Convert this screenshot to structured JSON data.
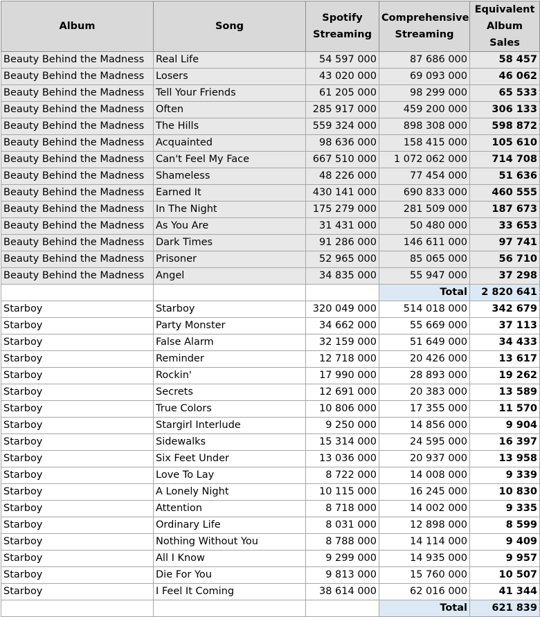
{
  "headers": {
    "album": "Album",
    "song": "Song",
    "spotify": "Spotify Streaming",
    "comprehensive": "Comprehensive Streaming",
    "equivalent": "Equivalent Album Sales"
  },
  "total_label": "Total",
  "section1": {
    "rows": [
      {
        "album": "Beauty Behind the Madness",
        "song": "Real Life",
        "spotify": "54 597 000",
        "comprehensive": "87 686 000",
        "sales": "58 457"
      },
      {
        "album": "Beauty Behind the Madness",
        "song": "Losers",
        "spotify": "43 020 000",
        "comprehensive": "69 093 000",
        "sales": "46 062"
      },
      {
        "album": "Beauty Behind the Madness",
        "song": "Tell Your Friends",
        "spotify": "61 205 000",
        "comprehensive": "98 299 000",
        "sales": "65 533"
      },
      {
        "album": "Beauty Behind the Madness",
        "song": "Often",
        "spotify": "285 917 000",
        "comprehensive": "459 200 000",
        "sales": "306 133"
      },
      {
        "album": "Beauty Behind the Madness",
        "song": "The Hills",
        "spotify": "559 324 000",
        "comprehensive": "898 308 000",
        "sales": "598 872"
      },
      {
        "album": "Beauty Behind the Madness",
        "song": "Acquainted",
        "spotify": "98 636 000",
        "comprehensive": "158 415 000",
        "sales": "105 610"
      },
      {
        "album": "Beauty Behind the Madness",
        "song": "Can't Feel My Face",
        "spotify": "667 510 000",
        "comprehensive": "1 072 062 000",
        "sales": "714 708"
      },
      {
        "album": "Beauty Behind the Madness",
        "song": "Shameless",
        "spotify": "48 226 000",
        "comprehensive": "77 454 000",
        "sales": "51 636"
      },
      {
        "album": "Beauty Behind the Madness",
        "song": "Earned It",
        "spotify": "430 141 000",
        "comprehensive": "690 833 000",
        "sales": "460 555"
      },
      {
        "album": "Beauty Behind the Madness",
        "song": "In The Night",
        "spotify": "175 279 000",
        "comprehensive": "281 509 000",
        "sales": "187 673"
      },
      {
        "album": "Beauty Behind the Madness",
        "song": "As You Are",
        "spotify": "31 431 000",
        "comprehensive": "50 480 000",
        "sales": "33 653"
      },
      {
        "album": "Beauty Behind the Madness",
        "song": "Dark Times",
        "spotify": "91 286 000",
        "comprehensive": "146 611 000",
        "sales": "97 741"
      },
      {
        "album": "Beauty Behind the Madness",
        "song": "Prisoner",
        "spotify": "52 965 000",
        "comprehensive": "85 065 000",
        "sales": "56 710"
      },
      {
        "album": "Beauty Behind the Madness",
        "song": "Angel",
        "spotify": "34 835 000",
        "comprehensive": "55 947 000",
        "sales": "37 298"
      }
    ],
    "total": "2 820 641"
  },
  "section2": {
    "rows": [
      {
        "album": "Starboy",
        "song": "Starboy",
        "spotify": "320 049 000",
        "comprehensive": "514 018 000",
        "sales": "342 679"
      },
      {
        "album": "Starboy",
        "song": "Party Monster",
        "spotify": "34 662 000",
        "comprehensive": "55 669 000",
        "sales": "37 113"
      },
      {
        "album": "Starboy",
        "song": "False Alarm",
        "spotify": "32 159 000",
        "comprehensive": "51 649 000",
        "sales": "34 433"
      },
      {
        "album": "Starboy",
        "song": "Reminder",
        "spotify": "12 718 000",
        "comprehensive": "20 426 000",
        "sales": "13 617"
      },
      {
        "album": "Starboy",
        "song": "Rockin'",
        "spotify": "17 990 000",
        "comprehensive": "28 893 000",
        "sales": "19 262"
      },
      {
        "album": "Starboy",
        "song": "Secrets",
        "spotify": "12 691 000",
        "comprehensive": "20 383 000",
        "sales": "13 589"
      },
      {
        "album": "Starboy",
        "song": "True Colors",
        "spotify": "10 806 000",
        "comprehensive": "17 355 000",
        "sales": "11 570"
      },
      {
        "album": "Starboy",
        "song": "Stargirl Interlude",
        "spotify": "9 250 000",
        "comprehensive": "14 856 000",
        "sales": "9 904"
      },
      {
        "album": "Starboy",
        "song": "Sidewalks",
        "spotify": "15 314 000",
        "comprehensive": "24 595 000",
        "sales": "16 397"
      },
      {
        "album": "Starboy",
        "song": "Six Feet Under",
        "spotify": "13 036 000",
        "comprehensive": "20 937 000",
        "sales": "13 958"
      },
      {
        "album": "Starboy",
        "song": "Love To Lay",
        "spotify": "8 722 000",
        "comprehensive": "14 008 000",
        "sales": "9 339"
      },
      {
        "album": "Starboy",
        "song": "A Lonely Night",
        "spotify": "10 115 000",
        "comprehensive": "16 245 000",
        "sales": "10 830"
      },
      {
        "album": "Starboy",
        "song": "Attention",
        "spotify": "8 718 000",
        "comprehensive": "14 002 000",
        "sales": "9 335"
      },
      {
        "album": "Starboy",
        "song": "Ordinary Life",
        "spotify": "8 031 000",
        "comprehensive": "12 898 000",
        "sales": "8 599"
      },
      {
        "album": "Starboy",
        "song": "Nothing Without You",
        "spotify": "8 788 000",
        "comprehensive": "14 114 000",
        "sales": "9 409"
      },
      {
        "album": "Starboy",
        "song": "All I Know",
        "spotify": "9 299 000",
        "comprehensive": "14 935 000",
        "sales": "9 957"
      },
      {
        "album": "Starboy",
        "song": "Die For You",
        "spotify": "9 813 000",
        "comprehensive": "15 760 000",
        "sales": "10 507"
      },
      {
        "album": "Starboy",
        "song": "I Feel It Coming",
        "spotify": "38 614 000",
        "comprehensive": "62 016 000",
        "sales": "41 344"
      }
    ],
    "total": "621 839"
  }
}
